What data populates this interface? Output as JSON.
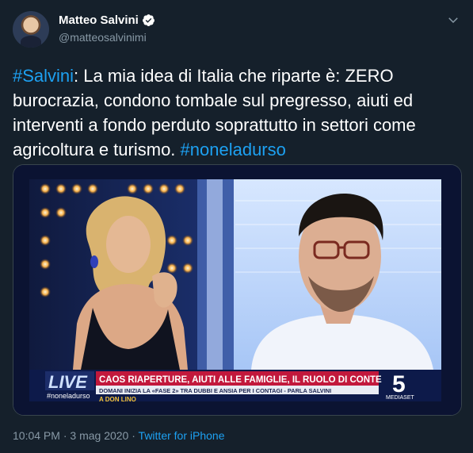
{
  "author": {
    "name": "Matteo Salvini",
    "handle": "@matteosalvinimi",
    "verified": true
  },
  "tweet": {
    "segments": [
      {
        "text": "#Salvini",
        "type": "hashtag"
      },
      {
        "text": ": La mia idea di Italia che riparte è: ZERO burocrazia, condono tombale sul pregresso, aiuti ed interventi a fondo perduto soprattutto in settori come agricoltura e turismo. ",
        "type": "text"
      },
      {
        "text": "#noneladurso",
        "type": "hashtag"
      }
    ]
  },
  "media": {
    "live_label": "LIVE",
    "live_hashtag": "#noneladurso",
    "headline": "CAOS RIAPERTURE, AIUTI ALLE FAMIGLIE, IL RUOLO DI CONTE",
    "subheadline": "DOMANI INIZIA LA «FASE 2» TRA DUBBI E ANSIA PER I CONTAGI - PARLA SALVINI",
    "ticker": "A DON LINO",
    "channel_number": "5",
    "channel_name": "MEDIASET"
  },
  "footer": {
    "time": "10:04 PM",
    "separator": " · ",
    "date": "3 mag 2020",
    "source": "Twitter for iPhone"
  },
  "colors": {
    "background": "#15202b",
    "link": "#1da1f2",
    "secondary_text": "#8899a6"
  },
  "icons": [
    "verified-badge-icon",
    "chevron-down-icon"
  ]
}
